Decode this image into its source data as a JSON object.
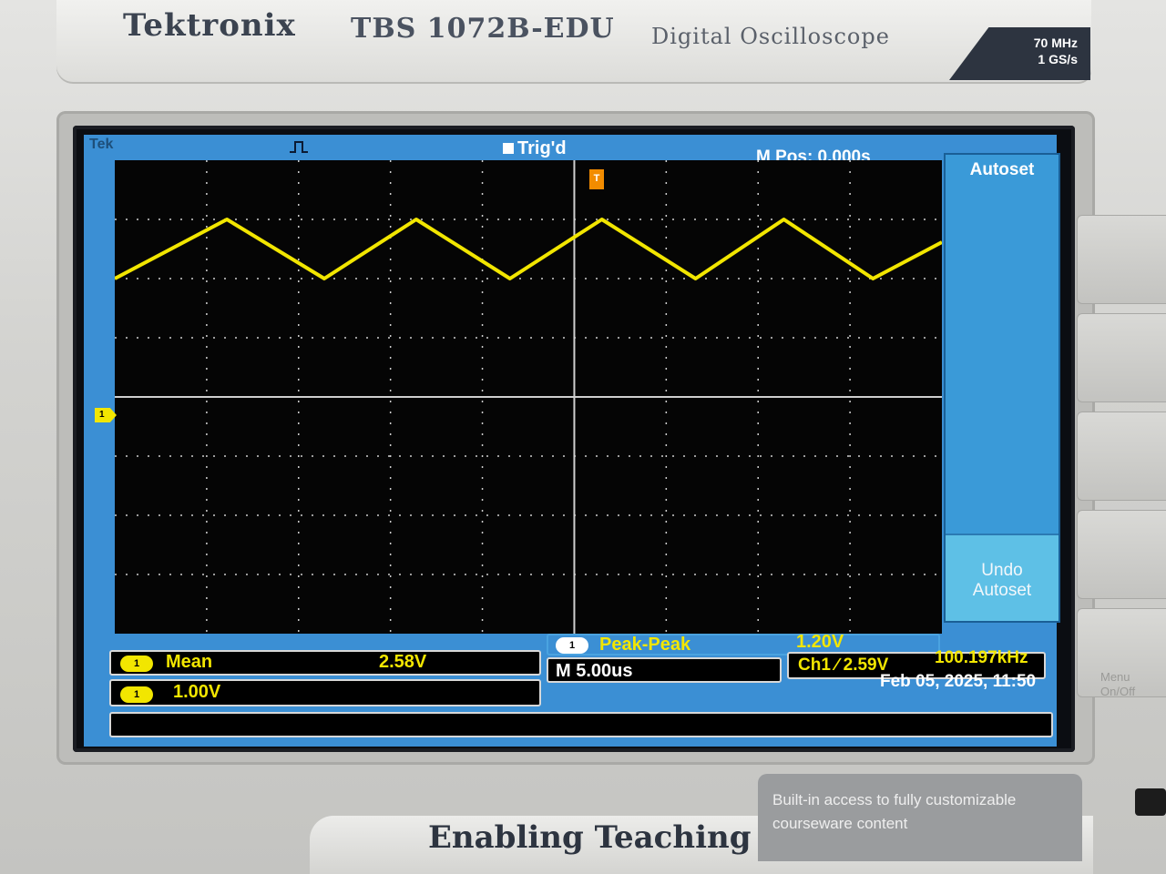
{
  "header": {
    "brand": "Tektronix",
    "model": "TBS 1072B-EDU",
    "description": "Digital Oscilloscope",
    "spec_bandwidth": "70 MHz",
    "spec_sample_rate": "1 GS/s"
  },
  "status_bar": {
    "tek_label": "Tek",
    "trigger_status": "Trig'd",
    "m_pos": "M Pos: 0.000s"
  },
  "menu": {
    "autoset": "Autoset",
    "undo_autoset_line1": "Undo",
    "undo_autoset_line2": "Autoset"
  },
  "markers": {
    "channel": "1",
    "trigger": "T"
  },
  "readouts": {
    "mean_label": "Mean",
    "mean_value": "2.58V",
    "peak_peak_label": "Peak-Peak",
    "peak_peak_value": "1.20V",
    "ch1_scale": "1.00V",
    "timebase": "M 5.00us",
    "trigger_level": "Ch1 ∕ 2.59V",
    "frequency": "100.197kHz",
    "datetime": "Feb 05, 2025, 11:50",
    "badge_1": "1",
    "badge_2": "1",
    "badge_3": "1"
  },
  "waveform": {
    "color": "#f2e600",
    "shape": "triangle",
    "peaks_x_div": [
      1.22,
      3.28,
      5.3,
      7.28
    ],
    "troughs_x_div": [
      0.0,
      2.28,
      4.3,
      6.32,
      8.25
    ],
    "high_y_div": 3.0,
    "low_y_div": 2.0
  },
  "footer": {
    "slogan": "Enabling Teaching",
    "courseware_line1": "Built-in access to fully customizable",
    "courseware_line2": "courseware content",
    "menu_off_line1": "Menu",
    "menu_off_line2": "On/Off"
  }
}
